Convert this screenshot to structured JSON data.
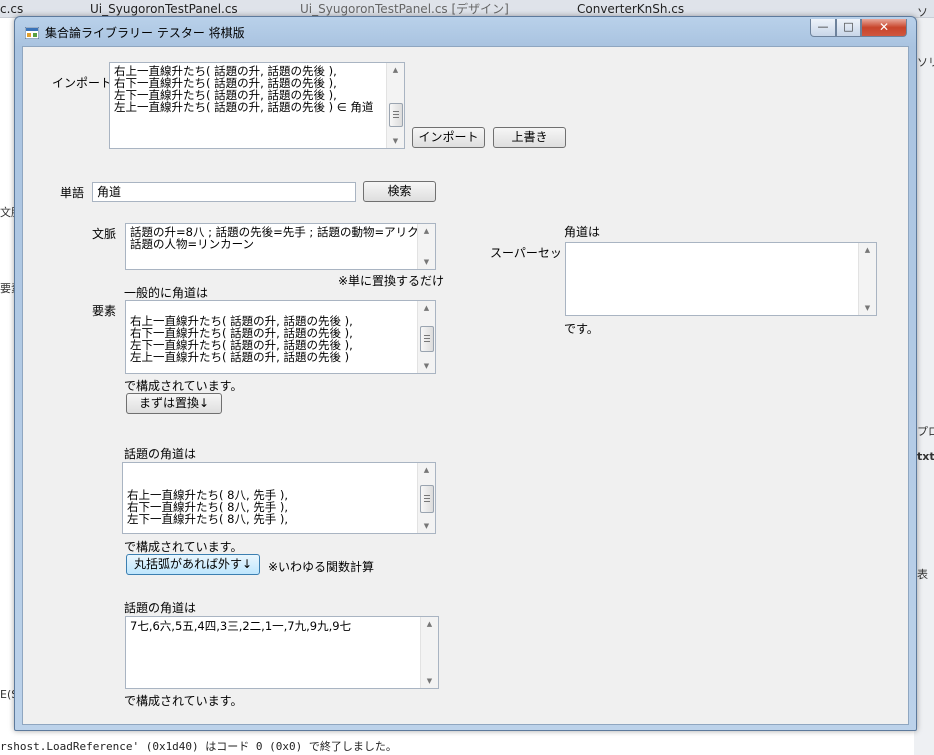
{
  "ide": {
    "tabs": [
      "c.cs",
      "Ui_SyugoronTestPanel.cs",
      "Ui_SyugoronTestPanel.cs [デザイン]",
      "ConverterKnSh.cs"
    ],
    "right_texts": [
      "ソ",
      "ソリ",
      "プロ",
      "txt",
      "表"
    ],
    "left_texts": [
      "文脈",
      "要素",
      "E(S"
    ],
    "output_lines": [
      "rshost.LoadReference' (0x1d40) はコード 0 (0x0) で終了しました。"
    ]
  },
  "window": {
    "title": "集合論ライブラリー テスター 将棋版",
    "minimize": "—",
    "maximize": "□",
    "close": "✕"
  },
  "import": {
    "label": "インポート",
    "text": "右上一直線升たち( 話題の升, 話題の先後 ),\n右下一直線升たち( 話題の升, 話題の先後 ),\n左下一直線升たち( 話題の升, 話題の先後 ),\n左上一直線升たち( 話題の升, 話題の先後 ) ∈ 角道",
    "import_button": "インポート",
    "overwrite_button": "上書き"
  },
  "word": {
    "label": "単語",
    "value": "角道",
    "search_button": "検索"
  },
  "context": {
    "label": "文脈",
    "text": "話題の升=8八 ; 話題の先後=先手 ; 話題の動物=アリクイ ;\n話題の人物=リンカーン",
    "note": "※単に置換するだけ"
  },
  "elements": {
    "label": "要素",
    "heading": "一般的に角道は",
    "text": "\n右上一直線升たち( 話題の升, 話題の先後 ),\n右下一直線升たち( 話題の升, 話題の先後 ),\n左下一直線升たち( 話題の升, 話題の先後 ),\n左上一直線升たち( 話題の升, 話題の先後 )",
    "footer": "で構成されています。",
    "replace_button": "まずは置換↓"
  },
  "topic1": {
    "heading": "話題の角道は",
    "text": "\n\n右上一直線升たち( 8八, 先手 ),\n右下一直線升たち( 8八, 先手 ),\n左下一直線升たち( 8八, 先手 ),",
    "footer": "で構成されています。",
    "paren_button": "丸括弧があれば外す↓",
    "note": "※いわゆる関数計算"
  },
  "topic2": {
    "heading": "話題の角道は",
    "text": "7七,6六,5五,4四,3三,2二,1一,7九,9九,9七",
    "footer": "で構成されています。"
  },
  "superset": {
    "label": "スーパーセット",
    "heading": "角道は",
    "text": "",
    "footer": "です。"
  }
}
